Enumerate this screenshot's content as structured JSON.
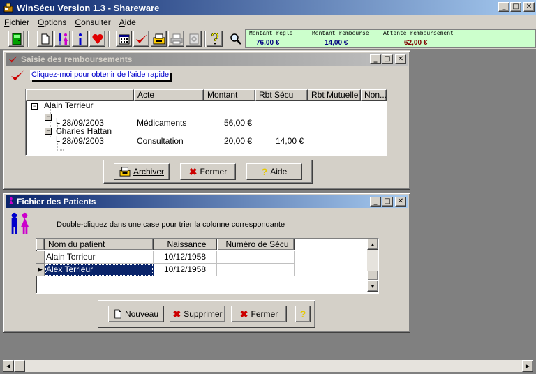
{
  "window": {
    "title": "WinSécu Version 1.3 - Shareware"
  },
  "menu": [
    {
      "label": "Fichier",
      "accel": "F"
    },
    {
      "label": "Options",
      "accel": "O"
    },
    {
      "label": "Consulter",
      "accel": "C"
    },
    {
      "label": "Aide",
      "accel": "A"
    }
  ],
  "status": {
    "montant_regle_label": "Montant réglé",
    "montant_regle_value": "76,00 €",
    "montant_rembourse_label": "Montant remboursé",
    "montant_rembourse_value": "14,00 €",
    "attente_label": "Attente remboursement",
    "attente_value": "62,00 €"
  },
  "saisie": {
    "title": "Saisie des remboursements",
    "help_link": "Cliquez-moi pour obtenir de l'aide rapide",
    "columns": [
      "",
      "Acte",
      "Montant",
      "Rbt Sécu",
      "Rbt Mutuelle",
      "Non..."
    ],
    "tree": {
      "root": "Alain Terrieur",
      "row1": {
        "date": "28/09/2003",
        "acte": "Médicaments",
        "montant": "56,00 €",
        "rbt_secu": ""
      },
      "child": "Charles Hattan",
      "row2": {
        "date": "28/09/2003",
        "acte": "Consultation",
        "montant": "20,00 €",
        "rbt_secu": "14,00 €"
      }
    },
    "buttons": {
      "archiver": "Archiver",
      "fermer": "Fermer",
      "aide": "Aide"
    }
  },
  "patients": {
    "title": "Fichier des Patients",
    "instruction": "Double-cliquez dans une case pour trier la colonne correspondante",
    "columns": [
      "Nom du patient",
      "Naissance",
      "Numéro de Sécu"
    ],
    "rows": [
      {
        "nom": "Alain Terrieur",
        "naissance": "10/12/1958",
        "secu": ""
      },
      {
        "nom": "Alex Terrieur",
        "naissance": "10/12/1958",
        "secu": ""
      }
    ],
    "buttons": {
      "nouveau": "Nouveau",
      "supprimer": "Supprimer",
      "fermer": "Fermer"
    }
  },
  "colors": {
    "title_active": "#0a246a",
    "status_bg": "#ccffcc",
    "check_red": "#cc0000",
    "link_blue": "#0000cc"
  }
}
